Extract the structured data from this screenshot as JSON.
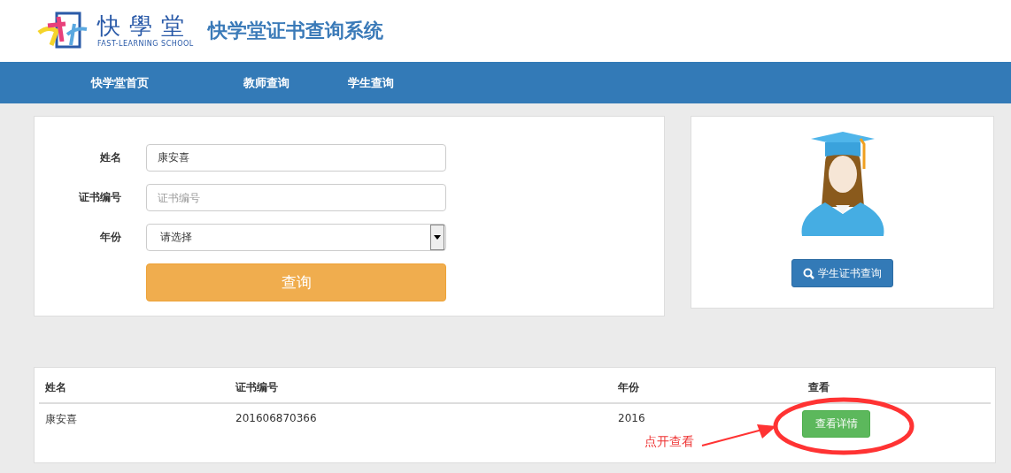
{
  "logo": {
    "name": "快學堂",
    "subtitle": "FAST-LEARNING SCHOOL"
  },
  "site_title": "快学堂证书查询系统",
  "nav": [
    {
      "label": "快学堂首页"
    },
    {
      "label": "教师查询"
    },
    {
      "label": "学生查询"
    }
  ],
  "form": {
    "fields": [
      {
        "kind": "text",
        "label": "姓名",
        "value": "康安喜"
      },
      {
        "kind": "text",
        "label": "证书编号",
        "placeholder": "证书编号"
      },
      {
        "kind": "select",
        "label": "年份",
        "value": "请选择"
      }
    ],
    "submit": "查询"
  },
  "side": {
    "button": "学生证书查询"
  },
  "table": {
    "columns": [
      "姓名",
      "证书编号",
      "年份",
      "查看"
    ],
    "rows": [
      {
        "cells": [
          "康安喜",
          "201606870366",
          "2016"
        ],
        "action": "查看详情"
      }
    ]
  },
  "annotation": {
    "text": "点开查看"
  }
}
